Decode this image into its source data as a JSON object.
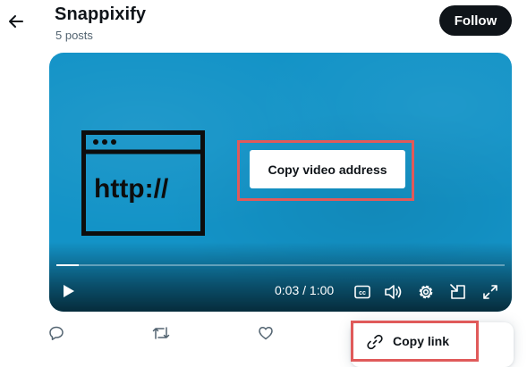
{
  "header": {
    "back_icon": "arrow-left-icon",
    "title": "Snappixify",
    "subtitle": "5 posts",
    "follow_label": "Follow"
  },
  "video": {
    "illustration_text": "http://",
    "copy_address_label": "Copy video address",
    "time": "0:03 / 1:00",
    "progress": 0.05,
    "controls": [
      "play-icon",
      "closed-captions-icon",
      "volume-icon",
      "gear-icon",
      "picture-in-picture-icon",
      "fullscreen-icon"
    ]
  },
  "actions": [
    "reply-icon",
    "repost-icon",
    "like-icon"
  ],
  "menu": {
    "copy_link_label": "Copy link",
    "copy_link_icon": "link-icon"
  },
  "colors": {
    "video_background": "#1393c7",
    "highlight": "#e05a5a",
    "follow_button": "#0f1419"
  }
}
